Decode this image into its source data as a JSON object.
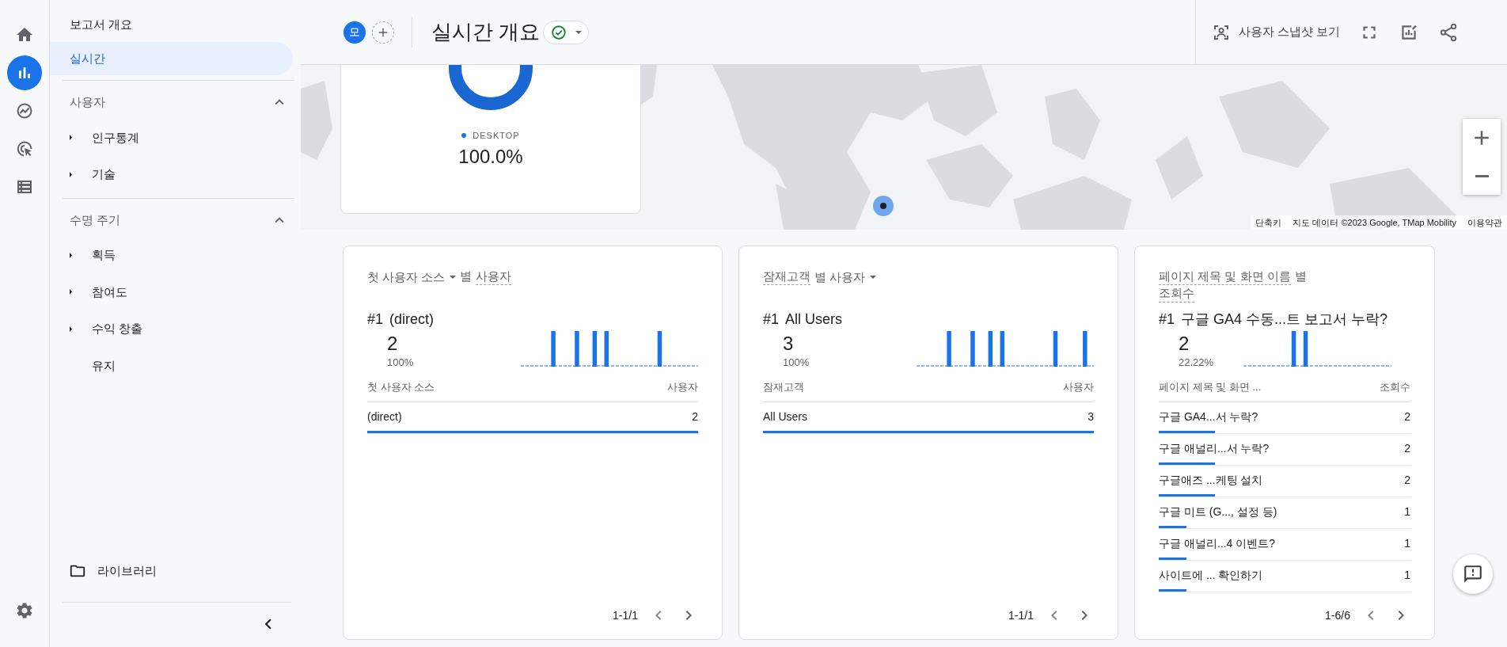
{
  "rail": {
    "items": [
      {
        "kind": "home",
        "selected": false
      },
      {
        "kind": "reports",
        "selected": true
      },
      {
        "kind": "explore",
        "selected": false
      },
      {
        "kind": "advertising",
        "selected": false
      },
      {
        "kind": "configure",
        "selected": false
      }
    ],
    "settings": {
      "kind": "settings"
    }
  },
  "nav": {
    "top_items": [
      {
        "label": "보고서 개요",
        "selected": false
      },
      {
        "label": "실시간",
        "selected": true
      }
    ],
    "sections": [
      {
        "label": "사용자",
        "expanded": true,
        "items": [
          {
            "label": "인구통계",
            "has_children": true
          },
          {
            "label": "기술",
            "has_children": true
          }
        ]
      },
      {
        "label": "수명 주기",
        "expanded": true,
        "items": [
          {
            "label": "획득",
            "has_children": true
          },
          {
            "label": "참여도",
            "has_children": true
          },
          {
            "label": "수익 창출",
            "has_children": true
          },
          {
            "label": "유지",
            "has_children": false
          }
        ]
      }
    ],
    "library": "라이브러리"
  },
  "header": {
    "avatar": "모",
    "title": "실시간 개요",
    "snapshot_button": "사용자 스냅샷 보기"
  },
  "map": {
    "attribution": [
      "단축키",
      "지도 데이터 ©2023 Google, TMap Mobility",
      "이용약관"
    ]
  },
  "device_card": {
    "legend": "DESKTOP",
    "value": "100.0%"
  },
  "cards": [
    {
      "title": [
        {
          "text": "첫 사용자 소스",
          "kind": "dropdown"
        },
        {
          "text": "별",
          "kind": "plain"
        },
        {
          "text": "사용자",
          "kind": "term"
        }
      ],
      "rank": "#1",
      "top_name": "(direct)",
      "top_value": "2",
      "top_share": "100%",
      "columns": [
        "첫 사용자 소스",
        "사용자"
      ],
      "rows": [
        {
          "label": "(direct)",
          "value": "2",
          "level": 1
        }
      ],
      "pagination": "1-1/1"
    },
    {
      "title": [
        {
          "text": "잠재고객",
          "kind": "term"
        },
        {
          "text": "별 사용자",
          "kind": "dropdown"
        }
      ],
      "rank": "#1",
      "top_name": "All Users",
      "top_value": "3",
      "top_share": "100%",
      "columns": [
        "잠재고객",
        "사용자"
      ],
      "rows": [
        {
          "label": "All Users",
          "value": "3",
          "level": 1
        }
      ],
      "pagination": "1-1/1"
    },
    {
      "title": [
        {
          "text": "페이지 제목 및 화면 이름",
          "kind": "term"
        },
        {
          "text": "별",
          "kind": "plain"
        },
        {
          "text": "조회수",
          "kind": "term"
        }
      ],
      "rank": "#1",
      "top_name": "구글 GA4 수동...트 보고서 누락?",
      "top_value": "2",
      "top_share": "22.22%",
      "columns": [
        "페이지 제목 및 화면 ...",
        "조회수"
      ],
      "rows": [
        {
          "label": "구글 GA4...서 누락?",
          "value": "2",
          "level": 0.2222
        },
        {
          "label": "구글 애널리...서 누락?",
          "value": "2",
          "level": 0.2222
        },
        {
          "label": "구글애즈 ...케팅 설치",
          "value": "2",
          "level": 0.2222
        },
        {
          "label": "구글 미트 (G..., 설정 등)",
          "value": "1",
          "level": 0.1111
        },
        {
          "label": "구글 애널리...4 이벤트?",
          "value": "1",
          "level": 0.1111
        },
        {
          "label": "사이트에 ... 확인하기",
          "value": "1",
          "level": 0.1111
        }
      ],
      "pagination": "1-6/6"
    }
  ]
}
